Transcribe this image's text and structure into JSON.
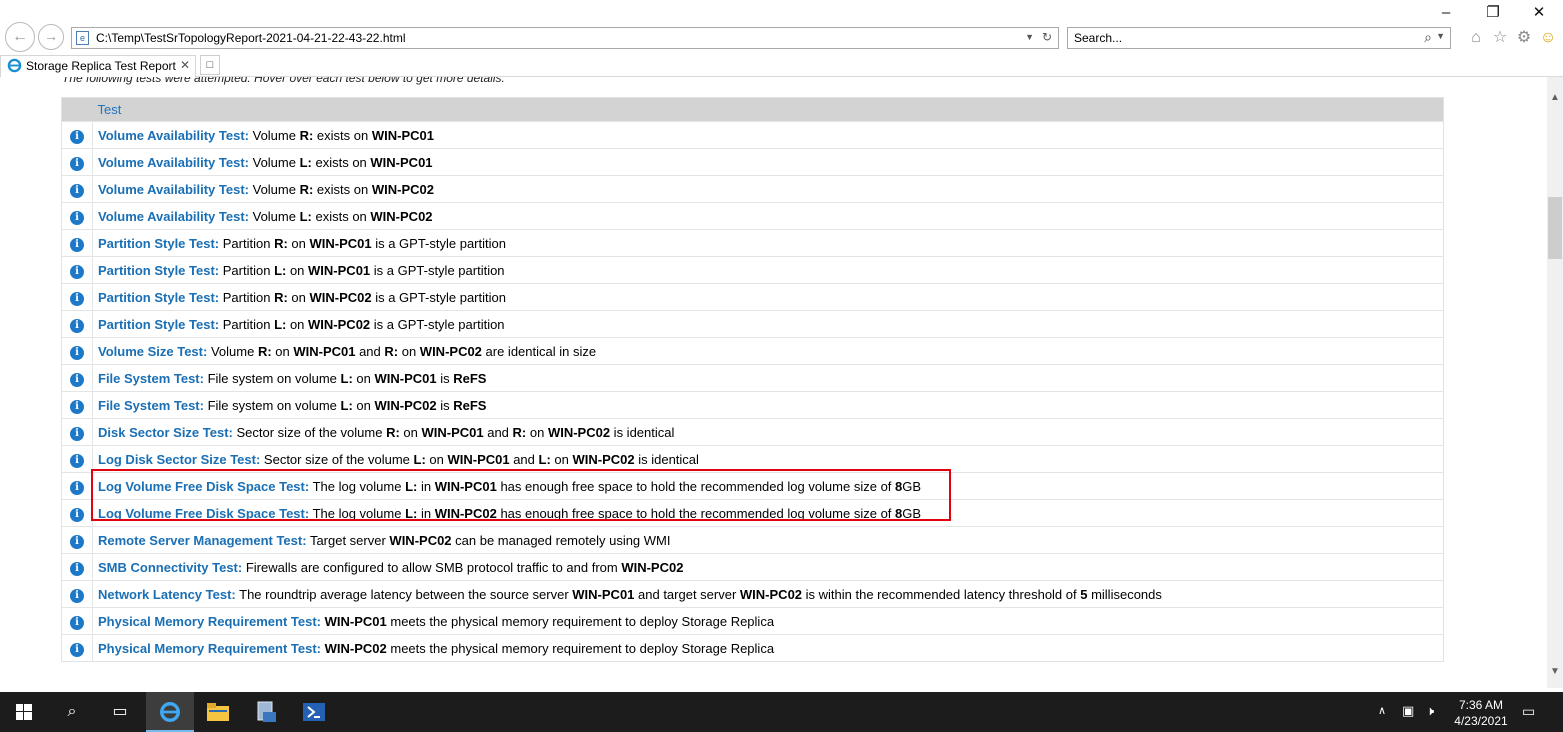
{
  "browser": {
    "address": "C:\\Temp\\TestSrTopologyReport-2021-04-21-22-43-22.html",
    "search_placeholder": "Search...",
    "tab_title": "Storage Replica Test Report"
  },
  "report": {
    "intro": "The following tests were attempted. Hover over each test below to get more details.",
    "column_header": "Test",
    "rows": [
      {
        "name": "Volume Availability Test:",
        "parts": [
          {
            "t": "Volume "
          },
          {
            "t": "R:",
            "b": true
          },
          {
            "t": " exists on "
          },
          {
            "t": "WIN-PC01",
            "b": true
          }
        ]
      },
      {
        "name": "Volume Availability Test:",
        "parts": [
          {
            "t": "Volume "
          },
          {
            "t": "L:",
            "b": true
          },
          {
            "t": " exists on "
          },
          {
            "t": "WIN-PC01",
            "b": true
          }
        ]
      },
      {
        "name": "Volume Availability Test:",
        "parts": [
          {
            "t": "Volume "
          },
          {
            "t": "R:",
            "b": true
          },
          {
            "t": " exists on "
          },
          {
            "t": "WIN-PC02",
            "b": true
          }
        ]
      },
      {
        "name": "Volume Availability Test:",
        "parts": [
          {
            "t": "Volume "
          },
          {
            "t": "L:",
            "b": true
          },
          {
            "t": " exists on "
          },
          {
            "t": "WIN-PC02",
            "b": true
          }
        ]
      },
      {
        "name": "Partition Style Test:",
        "parts": [
          {
            "t": "Partition "
          },
          {
            "t": "R:",
            "b": true
          },
          {
            "t": " on "
          },
          {
            "t": "WIN-PC01",
            "b": true
          },
          {
            "t": " is a GPT-style partition"
          }
        ]
      },
      {
        "name": "Partition Style Test:",
        "parts": [
          {
            "t": "Partition "
          },
          {
            "t": "L:",
            "b": true
          },
          {
            "t": " on "
          },
          {
            "t": "WIN-PC01",
            "b": true
          },
          {
            "t": " is a GPT-style partition"
          }
        ]
      },
      {
        "name": "Partition Style Test:",
        "parts": [
          {
            "t": "Partition "
          },
          {
            "t": "R:",
            "b": true
          },
          {
            "t": " on "
          },
          {
            "t": "WIN-PC02",
            "b": true
          },
          {
            "t": " is a GPT-style partition"
          }
        ]
      },
      {
        "name": "Partition Style Test:",
        "parts": [
          {
            "t": "Partition "
          },
          {
            "t": "L:",
            "b": true
          },
          {
            "t": " on "
          },
          {
            "t": "WIN-PC02",
            "b": true
          },
          {
            "t": " is a GPT-style partition"
          }
        ]
      },
      {
        "name": "Volume Size Test:",
        "parts": [
          {
            "t": "Volume "
          },
          {
            "t": "R:",
            "b": true
          },
          {
            "t": " on "
          },
          {
            "t": "WIN-PC01",
            "b": true
          },
          {
            "t": " and "
          },
          {
            "t": "R:",
            "b": true
          },
          {
            "t": " on "
          },
          {
            "t": "WIN-PC02",
            "b": true
          },
          {
            "t": " are identical in size"
          }
        ]
      },
      {
        "name": "File System Test:",
        "parts": [
          {
            "t": "File system on volume "
          },
          {
            "t": "L:",
            "b": true
          },
          {
            "t": " on "
          },
          {
            "t": "WIN-PC01",
            "b": true
          },
          {
            "t": " is "
          },
          {
            "t": "ReFS",
            "b": true
          }
        ]
      },
      {
        "name": "File System Test:",
        "parts": [
          {
            "t": "File system on volume "
          },
          {
            "t": "L:",
            "b": true
          },
          {
            "t": " on "
          },
          {
            "t": "WIN-PC02",
            "b": true
          },
          {
            "t": " is "
          },
          {
            "t": "ReFS",
            "b": true
          }
        ]
      },
      {
        "name": "Disk Sector Size Test:",
        "parts": [
          {
            "t": "Sector size of the volume "
          },
          {
            "t": "R:",
            "b": true
          },
          {
            "t": " on "
          },
          {
            "t": "WIN-PC01",
            "b": true
          },
          {
            "t": " and "
          },
          {
            "t": "R:",
            "b": true
          },
          {
            "t": " on "
          },
          {
            "t": "WIN-PC02",
            "b": true
          },
          {
            "t": " is identical"
          }
        ]
      },
      {
        "name": "Log Disk Sector Size Test:",
        "parts": [
          {
            "t": "Sector size of the volume "
          },
          {
            "t": "L:",
            "b": true
          },
          {
            "t": " on "
          },
          {
            "t": "WIN-PC01",
            "b": true
          },
          {
            "t": " and "
          },
          {
            "t": "L:",
            "b": true
          },
          {
            "t": " on "
          },
          {
            "t": "WIN-PC02",
            "b": true
          },
          {
            "t": " is identical"
          }
        ]
      },
      {
        "name": "Log Volume Free Disk Space Test:",
        "parts": [
          {
            "t": "The log volume "
          },
          {
            "t": "L:",
            "b": true
          },
          {
            "t": " in "
          },
          {
            "t": "WIN-PC01",
            "b": true
          },
          {
            "t": " has enough free space to hold the recommended log volume size of "
          },
          {
            "t": "8",
            "b": true
          },
          {
            "t": "GB"
          }
        ]
      },
      {
        "name": "Log Volume Free Disk Space Test:",
        "parts": [
          {
            "t": "The log volume "
          },
          {
            "t": "L:",
            "b": true
          },
          {
            "t": " in "
          },
          {
            "t": "WIN-PC02",
            "b": true
          },
          {
            "t": " has enough free space to hold the recommended log volume size of "
          },
          {
            "t": "8",
            "b": true
          },
          {
            "t": "GB"
          }
        ]
      },
      {
        "name": "Remote Server Management Test:",
        "parts": [
          {
            "t": "Target server "
          },
          {
            "t": "WIN-PC02",
            "b": true
          },
          {
            "t": " can be managed remotely using WMI"
          }
        ]
      },
      {
        "name": "SMB Connectivity Test:",
        "parts": [
          {
            "t": "Firewalls are configured to allow SMB protocol traffic to and from "
          },
          {
            "t": "WIN-PC02",
            "b": true
          }
        ]
      },
      {
        "name": "Network Latency Test:",
        "parts": [
          {
            "t": "The roundtrip average latency between the source server "
          },
          {
            "t": "WIN-PC01",
            "b": true
          },
          {
            "t": " and target server "
          },
          {
            "t": "WIN-PC02",
            "b": true
          },
          {
            "t": " is within the recommended latency threshold of "
          },
          {
            "t": "5",
            "b": true
          },
          {
            "t": " milliseconds"
          }
        ]
      },
      {
        "name": "Physical Memory Requirement Test:",
        "parts": [
          {
            "t": "WIN-PC01",
            "b": true
          },
          {
            "t": " meets the physical memory requirement to deploy Storage Replica"
          }
        ]
      },
      {
        "name": "Physical Memory Requirement Test:",
        "parts": [
          {
            "t": "WIN-PC02",
            "b": true
          },
          {
            "t": " meets the physical memory requirement to deploy Storage Replica"
          }
        ]
      }
    ]
  },
  "taskbar": {
    "time": "7:36 AM",
    "date": "4/23/2021"
  },
  "colors": {
    "link_blue": "#1a6fb5",
    "info_icon": "#1e78c8",
    "highlight_red": "#e3000f",
    "header_gray": "#d3d3d3"
  }
}
